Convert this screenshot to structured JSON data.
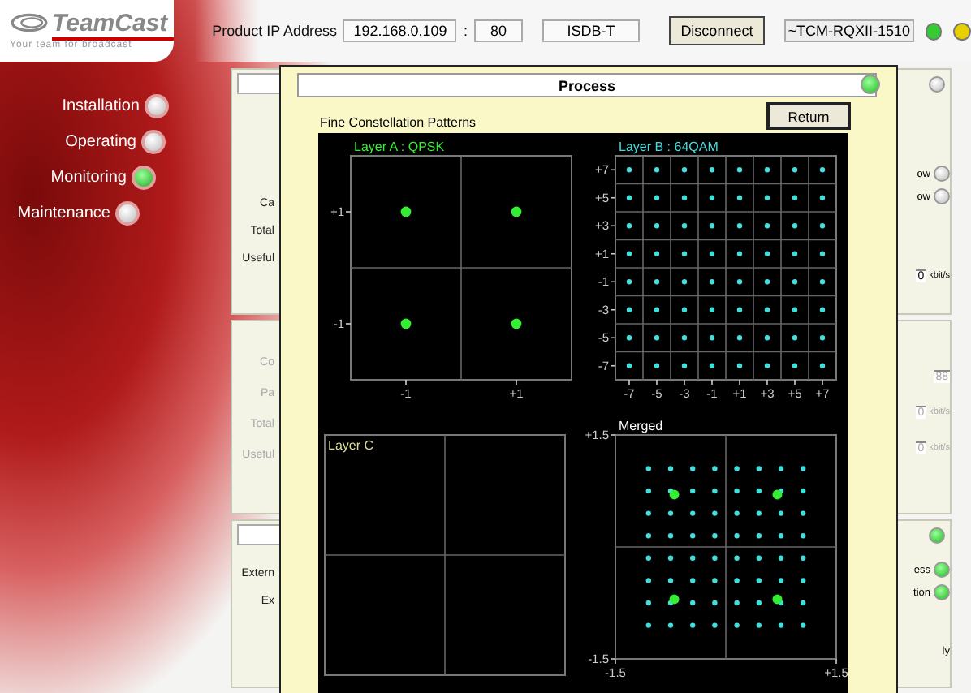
{
  "logo": {
    "name": "TeamCast",
    "tagline": "Your team for broadcast"
  },
  "top_bar": {
    "ip_label": "Product IP Address",
    "ip_address": "192.168.0.109",
    "separator": ":",
    "port": "80",
    "standard": "ISDB-T",
    "disconnect_button": "Disconnect",
    "device_name": "~TCM-RQXII-1510",
    "status_leds": [
      {
        "color": "#33cc33"
      },
      {
        "color": "#e8d000"
      }
    ]
  },
  "nav": {
    "items": [
      {
        "label": "Installation",
        "selected": false
      },
      {
        "label": "Operating",
        "selected": false
      },
      {
        "label": "Monitoring",
        "selected": true
      },
      {
        "label": "Maintenance",
        "selected": false
      }
    ]
  },
  "panels": [
    {
      "disabled": false,
      "header_led": {
        "on": false
      },
      "left_labels": [
        "Ca",
        "Total",
        "Useful"
      ],
      "right_items": [
        {
          "kind": "led",
          "label": "ow",
          "on": false
        },
        {
          "kind": "led",
          "label": "ow",
          "on": false
        },
        {
          "kind": "value",
          "value": "0",
          "unit": "kbit/s"
        }
      ]
    },
    {
      "disabled": true,
      "left_labels": [
        "Co",
        "Pa",
        "Total",
        "Useful"
      ],
      "right_items": [
        {
          "kind": "value",
          "value": "88"
        },
        {
          "kind": "value",
          "value": "0",
          "unit": "kbit/s"
        },
        {
          "kind": "value",
          "value": "0",
          "unit": "kbit/s"
        }
      ]
    },
    {
      "disabled": false,
      "header_led": {
        "on": true
      },
      "left_labels": [
        "Extern",
        "Ex"
      ],
      "right_items": [
        {
          "kind": "led",
          "label": "ess",
          "on": true
        },
        {
          "kind": "led",
          "label": "tion",
          "on": true
        },
        {
          "kind": "text",
          "label": "ly"
        }
      ]
    }
  ],
  "dialog": {
    "title": "Process",
    "status_led": {
      "on": true
    },
    "subtitle": "Fine Constellation Patterns",
    "return_button": "Return",
    "plots": [
      {
        "chart_data": {
          "type": "scatter",
          "title": "Layer A : QPSK",
          "x": [
            -1,
            1,
            -1,
            1
          ],
          "series": [
            {
              "color": "#33ee33",
              "values": [
                1,
                1,
                -1,
                -1
              ]
            }
          ],
          "xlim": [
            -2,
            2
          ],
          "ylim": [
            -2,
            2
          ],
          "grid": true,
          "xticks": [
            {
              "value": -1,
              "label": "-1"
            },
            {
              "value": 1,
              "label": "+1"
            }
          ],
          "yticks": [
            {
              "value": 1,
              "label": "+1"
            },
            {
              "value": -1,
              "label": "-1"
            }
          ]
        }
      },
      {
        "chart_data": {
          "type": "scatter",
          "title": "Layer B : 64QAM",
          "x": [
            -7,
            -5,
            -3,
            -1,
            1,
            3,
            5,
            7,
            -7,
            -5,
            -3,
            -1,
            1,
            3,
            5,
            7,
            -7,
            -5,
            -3,
            -1,
            1,
            3,
            5,
            7,
            -7,
            -5,
            -3,
            -1,
            1,
            3,
            5,
            7,
            -7,
            -5,
            -3,
            -1,
            1,
            3,
            5,
            7,
            -7,
            -5,
            -3,
            -1,
            1,
            3,
            5,
            7,
            -7,
            -5,
            -3,
            -1,
            1,
            3,
            5,
            7,
            -7,
            -5,
            -3,
            -1,
            1,
            3,
            5,
            7
          ],
          "series": [
            {
              "color": "#44dddd",
              "values": [
                7,
                7,
                7,
                7,
                7,
                7,
                7,
                7,
                5,
                5,
                5,
                5,
                5,
                5,
                5,
                5,
                3,
                3,
                3,
                3,
                3,
                3,
                3,
                3,
                1,
                1,
                1,
                1,
                1,
                1,
                1,
                1,
                -1,
                -1,
                -1,
                -1,
                -1,
                -1,
                -1,
                -1,
                -3,
                -3,
                -3,
                -3,
                -3,
                -3,
                -3,
                -3,
                -5,
                -5,
                -5,
                -5,
                -5,
                -5,
                -5,
                -5,
                -7,
                -7,
                -7,
                -7,
                -7,
                -7,
                -7,
                -7
              ]
            }
          ],
          "xlim": [
            -8,
            8
          ],
          "ylim": [
            -8,
            8
          ],
          "grid": true,
          "xticks": [
            {
              "value": -7,
              "label": "-7"
            },
            {
              "value": -5,
              "label": "-5"
            },
            {
              "value": -3,
              "label": "-3"
            },
            {
              "value": -1,
              "label": "-1"
            },
            {
              "value": 1,
              "label": "+1"
            },
            {
              "value": 3,
              "label": "+3"
            },
            {
              "value": 5,
              "label": "+5"
            },
            {
              "value": 7,
              "label": "+7"
            }
          ],
          "yticks": [
            {
              "value": 7,
              "label": "+7"
            },
            {
              "value": 5,
              "label": "+5"
            },
            {
              "value": 3,
              "label": "+3"
            },
            {
              "value": 1,
              "label": "+1"
            },
            {
              "value": -1,
              "label": "-1"
            },
            {
              "value": -3,
              "label": "-3"
            },
            {
              "value": -5,
              "label": "-5"
            },
            {
              "value": -7,
              "label": "-7"
            }
          ]
        }
      },
      {
        "title": "Layer C"
      },
      {
        "chart_data": {
          "type": "scatter",
          "title": "Merged",
          "x": [
            -1.05,
            -0.75,
            -0.45,
            -0.15,
            0.15,
            0.45,
            0.75,
            1.05,
            -1.05,
            -0.75,
            -0.45,
            -0.15,
            0.15,
            0.45,
            0.75,
            1.05,
            -1.05,
            -0.75,
            -0.45,
            -0.15,
            0.15,
            0.45,
            0.75,
            1.05,
            -1.05,
            -0.75,
            -0.45,
            -0.15,
            0.15,
            0.45,
            0.75,
            1.05,
            -1.05,
            -0.75,
            -0.45,
            -0.15,
            0.15,
            0.45,
            0.75,
            1.05,
            -1.05,
            -0.75,
            -0.45,
            -0.15,
            0.15,
            0.45,
            0.75,
            1.05,
            -1.05,
            -0.75,
            -0.45,
            -0.15,
            0.15,
            0.45,
            0.75,
            1.05,
            -1.05,
            -0.75,
            -0.45,
            -0.15,
            0.15,
            0.45,
            0.75,
            1.05,
            -0.7,
            0.7,
            -0.7,
            0.7
          ],
          "series": [
            {
              "color": "#44dddd",
              "values": [
                1.05,
                1.05,
                1.05,
                1.05,
                1.05,
                1.05,
                1.05,
                1.05,
                0.75,
                0.75,
                0.75,
                0.75,
                0.75,
                0.75,
                0.75,
                0.75,
                0.45,
                0.45,
                0.45,
                0.45,
                0.45,
                0.45,
                0.45,
                0.45,
                0.15,
                0.15,
                0.15,
                0.15,
                0.15,
                0.15,
                0.15,
                0.15,
                -0.15,
                -0.15,
                -0.15,
                -0.15,
                -0.15,
                -0.15,
                -0.15,
                -0.15,
                -0.45,
                -0.45,
                -0.45,
                -0.45,
                -0.45,
                -0.45,
                -0.45,
                -0.45,
                -0.75,
                -0.75,
                -0.75,
                -0.75,
                -0.75,
                -0.75,
                -0.75,
                -0.75,
                -1.05,
                -1.05,
                -1.05,
                -1.05,
                -1.05,
                -1.05,
                -1.05,
                -1.05,
                null,
                null,
                null,
                null
              ]
            },
            {
              "color": "#33ee33",
              "values": [
                null,
                null,
                null,
                null,
                null,
                null,
                null,
                null,
                null,
                null,
                null,
                null,
                null,
                null,
                null,
                null,
                null,
                null,
                null,
                null,
                null,
                null,
                null,
                null,
                null,
                null,
                null,
                null,
                null,
                null,
                null,
                null,
                null,
                null,
                null,
                null,
                null,
                null,
                null,
                null,
                null,
                null,
                null,
                null,
                null,
                null,
                null,
                null,
                null,
                null,
                null,
                null,
                null,
                null,
                null,
                null,
                null,
                null,
                null,
                null,
                null,
                null,
                null,
                null,
                0.7,
                0.7,
                -0.7,
                -0.7
              ]
            }
          ],
          "xlim": [
            -1.5,
            1.5
          ],
          "ylim": [
            -1.5,
            1.5
          ],
          "grid": true,
          "xticks": [
            {
              "value": -1.5,
              "label": "-1.5"
            },
            {
              "value": 1.5,
              "label": "+1.5"
            }
          ],
          "yticks": [
            {
              "value": 1.5,
              "label": "+1.5"
            },
            {
              "value": -1.5,
              "label": "-1.5"
            }
          ]
        }
      }
    ]
  }
}
